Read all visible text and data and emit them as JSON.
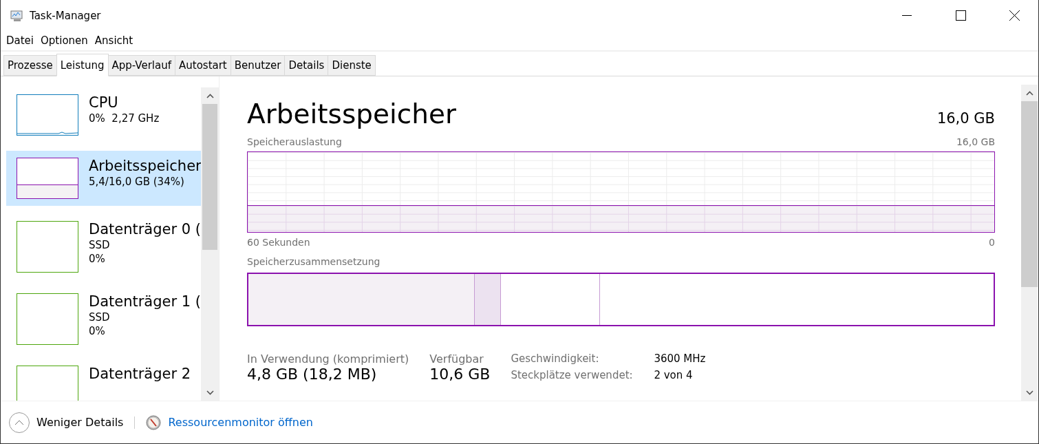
{
  "window": {
    "title": "Task-Manager"
  },
  "menu": [
    {
      "label": "Datei"
    },
    {
      "label": "Optionen"
    },
    {
      "label": "Ansicht"
    }
  ],
  "tabs": [
    {
      "label": "Prozesse",
      "selected": false
    },
    {
      "label": "Leistung",
      "selected": true
    },
    {
      "label": "App-Verlauf",
      "selected": false
    },
    {
      "label": "Autostart",
      "selected": false
    },
    {
      "label": "Benutzer",
      "selected": false
    },
    {
      "label": "Details",
      "selected": false
    },
    {
      "label": "Dienste",
      "selected": false
    }
  ],
  "sidebar": {
    "items": [
      {
        "kind": "cpu",
        "name": "CPU",
        "lines": [
          "0%  2,27 GHz"
        ],
        "selected": false
      },
      {
        "kind": "memory",
        "name": "Arbeitsspeicher",
        "lines": [
          "5,4/16,0 GB (34%)"
        ],
        "selected": true
      },
      {
        "kind": "disk",
        "name": "Datenträger 0 (",
        "lines": [
          "SSD",
          "0%"
        ],
        "selected": false
      },
      {
        "kind": "disk",
        "name": "Datenträger 1 (",
        "lines": [
          "SSD",
          "0%"
        ],
        "selected": false
      },
      {
        "kind": "disk",
        "name": "Datenträger 2",
        "selected": false
      }
    ]
  },
  "main": {
    "title": "Arbeitsspeicher",
    "total": "16,0 GB",
    "usage_graph": {
      "label": "Speicherauslastung",
      "max": "16,0 GB",
      "x_start": "60 Sekunden",
      "x_end": "0"
    },
    "composition": {
      "label": "Speicherzusammensetzung"
    },
    "stats": [
      {
        "label": "In Verwendung (komprimiert)",
        "value": "4,8 GB (18,2 MB)"
      },
      {
        "label": "Verfügbar",
        "value": "10,6 GB"
      }
    ],
    "details": [
      {
        "label": "Geschwindigkeit:",
        "value": "3600 MHz"
      },
      {
        "label": "Steckplätze verwendet:",
        "value": "2 von 4"
      }
    ]
  },
  "footer": {
    "toggle": "Weniger Details",
    "link": "Ressourcenmonitor öffnen"
  }
}
